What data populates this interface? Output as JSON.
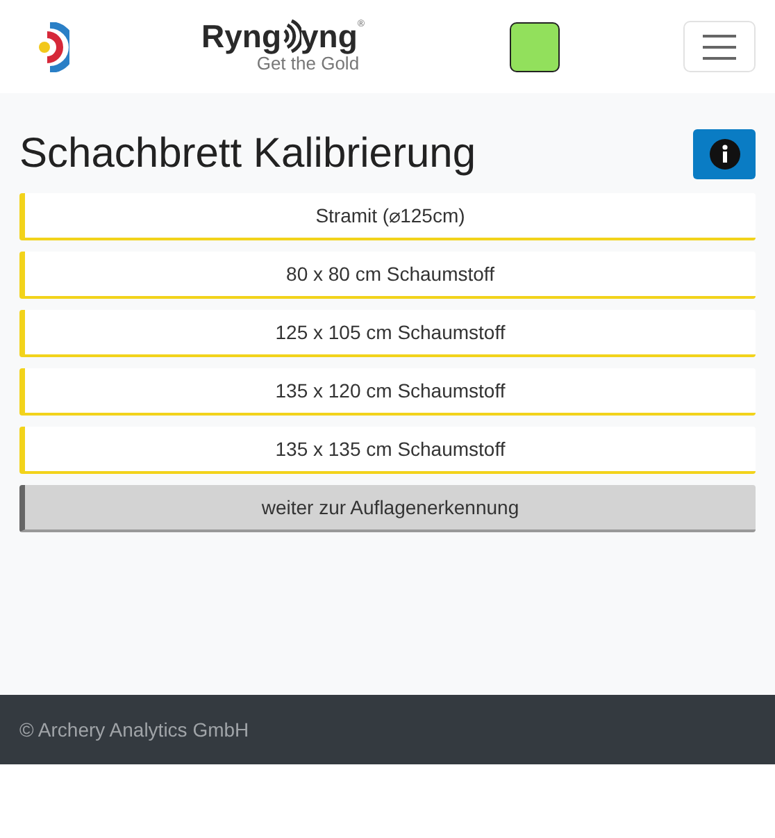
{
  "navbar": {
    "logo": {
      "left": "Ryng",
      "right": "yng",
      "registered": "®",
      "tagline": "Get the Gold"
    },
    "status_ok": true
  },
  "heading": "Schachbrett Kalibrierung",
  "options": [
    {
      "kind": "target",
      "label": "Stramit (⌀125cm)"
    },
    {
      "kind": "target",
      "label": "80 x 80 cm Schaumstoff"
    },
    {
      "kind": "target",
      "label": "125 x 105 cm Schaumstoff"
    },
    {
      "kind": "target",
      "label": "135 x 120 cm Schaumstoff"
    },
    {
      "kind": "target",
      "label": "135 x 135 cm Schaumstoff"
    },
    {
      "kind": "next",
      "label": "weiter zur Auflagenerkennung"
    }
  ],
  "footer": "© Archery Analytics GmbH"
}
